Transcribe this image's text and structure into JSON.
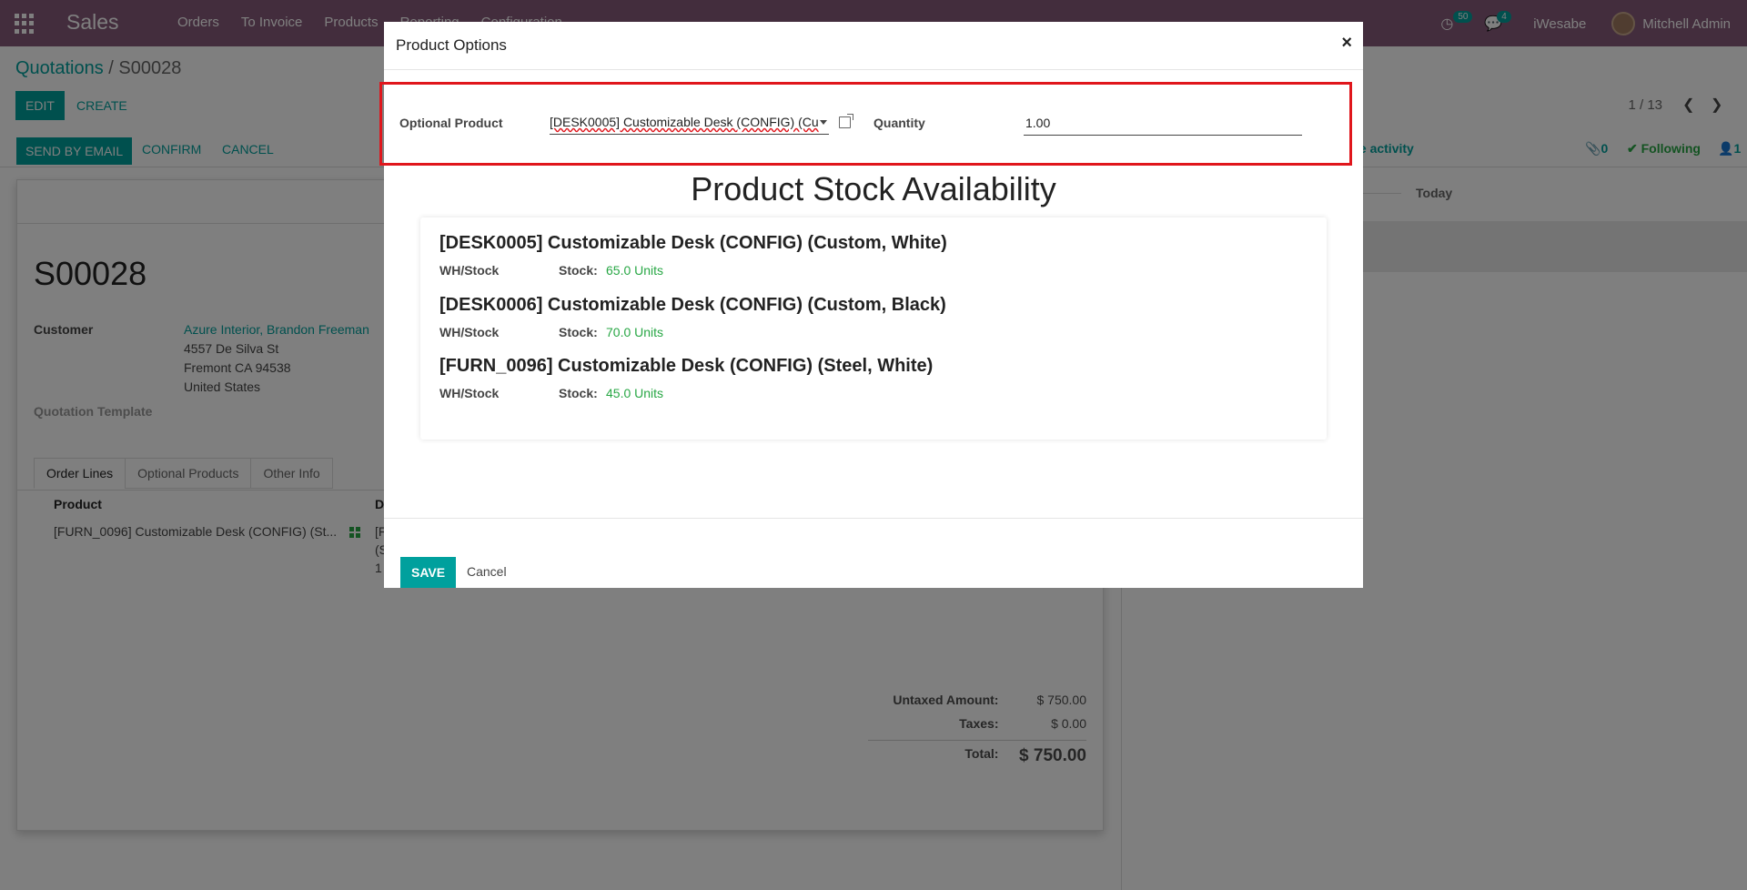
{
  "navbar": {
    "brand": "Sales",
    "menu": [
      "Orders",
      "To Invoice",
      "Products",
      "Reporting",
      "Configuration"
    ],
    "activity_count": "50",
    "message_count": "4",
    "company": "iWesabe",
    "user": "Mitchell Admin"
  },
  "control_panel": {
    "breadcrumb_parent": "Quotations",
    "breadcrumb_sep": "/",
    "breadcrumb_current": "S00028",
    "edit": "EDIT",
    "create": "CREATE",
    "pager": "1 / 13"
  },
  "statusbar": {
    "send_email": "SEND BY EMAIL",
    "confirm": "CONFIRM",
    "cancel": "CANCEL"
  },
  "form": {
    "name": "S00028",
    "customer_label": "Customer",
    "customer_name": "Azure Interior, Brandon Freeman",
    "address_line1": "4557 De Silva St",
    "address_line2": "Fremont CA 94538",
    "address_line3": "United States",
    "template_label": "Quotation Template",
    "tabs": [
      "Order Lines",
      "Optional Products",
      "Other Info"
    ],
    "col_product": "Product",
    "col_description": "D",
    "line_product": "[FURN_0096] Customizable Desk (CONFIG) (St...",
    "line_desc_1": "[F",
    "line_desc_2": "(S",
    "line_desc_3": "1",
    "untaxed_label": "Untaxed Amount:",
    "untaxed_value": "$ 750.00",
    "taxes_label": "Taxes:",
    "taxes_value": "$ 0.00",
    "total_label": "Total:",
    "total_value": "$ 750.00"
  },
  "chatter": {
    "activity": "le activity",
    "attachments": "0",
    "following": "Following",
    "followers": "1",
    "today": "Today"
  },
  "modal": {
    "title": "Product Options",
    "close": "×",
    "optional_product_label": "Optional Product",
    "optional_product_value": "[DESK0005] Customizable Desk (CONFIG) (Cu",
    "quantity_label": "Quantity",
    "quantity_value": "1.00",
    "stock_title": "Product Stock Availability",
    "stock_items": [
      {
        "name": "[DESK0005] Customizable Desk (CONFIG) (Custom, White)",
        "location": "WH/Stock",
        "stock_label": "Stock:",
        "stock_value": "65.0 Units"
      },
      {
        "name": "[DESK0006] Customizable Desk (CONFIG) (Custom, Black)",
        "location": "WH/Stock",
        "stock_label": "Stock:",
        "stock_value": "70.0 Units"
      },
      {
        "name": "[FURN_0096] Customizable Desk (CONFIG) (Steel, White)",
        "location": "WH/Stock",
        "stock_label": "Stock:",
        "stock_value": "45.0 Units"
      }
    ],
    "save": "SAVE",
    "cancel": "Cancel"
  },
  "colors": {
    "navbar": "#875a7b",
    "primary": "#00a09d",
    "success": "#28a745",
    "highlight": "#e0161c"
  }
}
